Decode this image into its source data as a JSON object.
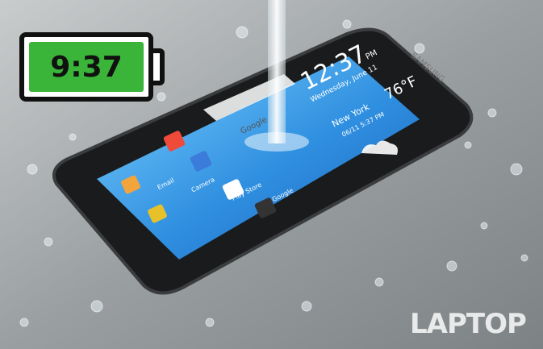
{
  "battery": {
    "time": "9:37"
  },
  "phone": {
    "clock": "12:37",
    "date": "Wednesday, June 11",
    "ampm": "PM",
    "brand": "SAMSUNG",
    "weather_city": "New York",
    "temperature": "76°F",
    "weather_updated": "06/11 5:37 PM",
    "search_label": "Google",
    "apps": [
      "Email",
      "Camera",
      "Play Store",
      "Google"
    ]
  },
  "watermark": "LAPTOP"
}
